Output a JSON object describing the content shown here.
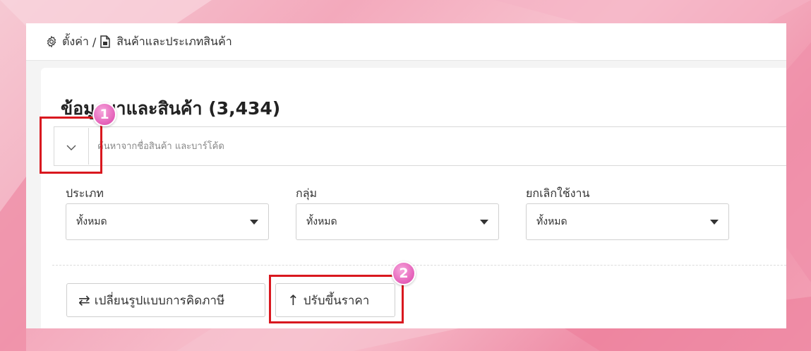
{
  "breadcrumb": {
    "settings_icon": "gear-icon",
    "settings_label": "ตั้งค่า",
    "separator": "/",
    "products_icon": "document-icon",
    "products_label": "สินค้าและประเภทสินค้า"
  },
  "page": {
    "title": "ข้อมูลยาและสินค้า (3,434)"
  },
  "search": {
    "toggle_icon": "chevron-down-icon",
    "placeholder": "ค้นหาจากชื่อสินค้า และบาร์โค้ด"
  },
  "filters": [
    {
      "label": "ประเภท",
      "value": "ทั้งหมด"
    },
    {
      "label": "กลุ่ม",
      "value": "ทั้งหมด"
    },
    {
      "label": "ยกเลิกใช้งาน",
      "value": "ทั้งหมด"
    }
  ],
  "actions": {
    "change_tax_label": "เปลี่ยนรูปแบบการคิดภาษี",
    "change_tax_icon": "swap-arrows-icon",
    "raise_price_label": "ปรับขึ้นราคา",
    "raise_price_icon": "arrow-up-icon"
  },
  "annotations": {
    "step1": "1",
    "step2": "2",
    "highlight_color": "#d9181f",
    "badge_color": "#e45fb8"
  }
}
